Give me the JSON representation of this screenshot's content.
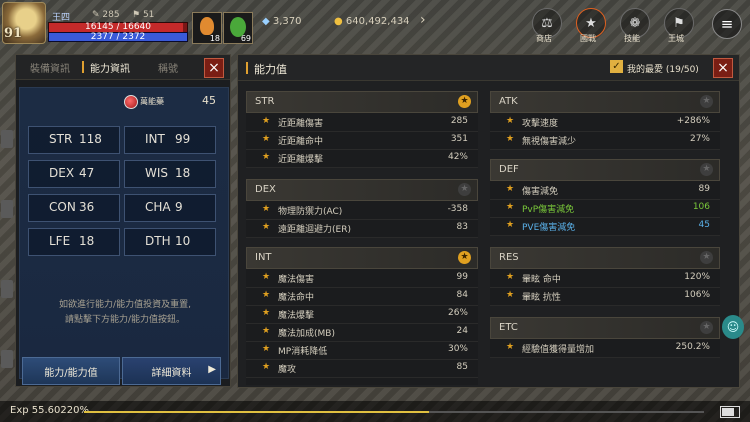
{
  "player": {
    "level": "91",
    "name": "王四",
    "hp_text": "16145 / 16640",
    "hp_fraction": 0.97,
    "mp_text": "2377 / 2372",
    "mp_fraction": 1.0,
    "ac": "285",
    "stat2": "51",
    "slot1_count": "18",
    "slot2_count": "69",
    "crystals": "3,370",
    "gold": "640,492,434",
    "arrow": "›"
  },
  "hud_buttons": [
    {
      "icon": "⚖",
      "label": "商店"
    },
    {
      "icon": "★",
      "label": "國戰"
    },
    {
      "icon": "❁",
      "label": "技能"
    },
    {
      "icon": "⚑",
      "label": "王城"
    },
    {
      "icon": "≡",
      "label": ""
    }
  ],
  "left": {
    "tabs": [
      "裝備資訊",
      "能力資訊",
      "稱號"
    ],
    "close": "×",
    "potion_label": "萬能藥",
    "potion_count": "45",
    "stats": [
      {
        "name": "STR",
        "value": "118"
      },
      {
        "name": "INT",
        "value": "99"
      },
      {
        "name": "DEX",
        "value": "47"
      },
      {
        "name": "WIS",
        "value": "18"
      },
      {
        "name": "CON",
        "value": "36"
      },
      {
        "name": "CHA",
        "value": "9"
      },
      {
        "name": "LFE",
        "value": "18"
      },
      {
        "name": "DTH",
        "value": "10"
      }
    ],
    "info_line1": "如欲進行能力/能力值投資及重置,",
    "info_line2": "請點擊下方能力/能力值按鈕。",
    "btn_ability": "能力/能力值",
    "btn_detail": "詳細資料",
    "btn_detail_arrow": "▶"
  },
  "right": {
    "title": "能力值",
    "favorites_check": "✓",
    "favorites_label": "我的最愛 (19/50)",
    "close": "×",
    "sections_left": [
      {
        "title": "STR",
        "starred": true,
        "star": "★",
        "rows": [
          {
            "label": "近距離傷害",
            "value": "285"
          },
          {
            "label": "近距離命中",
            "value": "351"
          },
          {
            "label": "近距離爆擊",
            "value": "42%"
          }
        ]
      },
      {
        "title": "DEX",
        "starred": false,
        "star": "★",
        "rows": [
          {
            "label": "物理防禦力(AC)",
            "value": "-358"
          },
          {
            "label": "遠距離迴避力(ER)",
            "value": "83"
          }
        ]
      },
      {
        "title": "INT",
        "starred": true,
        "star": "★",
        "rows": [
          {
            "label": "魔法傷害",
            "value": "99"
          },
          {
            "label": "魔法命中",
            "value": "84"
          },
          {
            "label": "魔法爆擊",
            "value": "26%"
          },
          {
            "label": "魔法加成(MB)",
            "value": "24"
          },
          {
            "label": "MP消耗降低",
            "value": "30%"
          },
          {
            "label": "魔攻",
            "value": "85"
          }
        ]
      }
    ],
    "sections_right": [
      {
        "title": "ATK",
        "starred": false,
        "star": "★",
        "rows": [
          {
            "label": "攻擊速度",
            "value": "+286%",
            "color": ""
          },
          {
            "label": "無視傷害減少",
            "value": "27%",
            "color": ""
          }
        ]
      },
      {
        "title": "DEF",
        "starred": false,
        "star": "★",
        "rows": [
          {
            "label": "傷害減免",
            "value": "89",
            "color": ""
          },
          {
            "label": "PvP傷害減免",
            "value": "106",
            "color": "green"
          },
          {
            "label": "PVE傷害減免",
            "value": "45",
            "color": "blue"
          }
        ]
      },
      {
        "title": "RES",
        "starred": false,
        "star": "★",
        "rows": [
          {
            "label": "暈眩 命中",
            "value": "120%",
            "color": ""
          },
          {
            "label": "暈眩 抗性",
            "value": "106%",
            "color": ""
          }
        ]
      },
      {
        "title": "ETC",
        "starred": false,
        "star": "★",
        "rows": [
          {
            "label": "經驗值獲得量增加",
            "value": "250.2%",
            "color": ""
          }
        ]
      }
    ]
  },
  "exp": {
    "text": "Exp  55.60220%",
    "fraction": 0.556,
    "battery_fraction": 0.85
  },
  "colors": {
    "accent_gold": "#e0a020",
    "hp_red": "#7a1616",
    "mp_blue": "#2a3c9c",
    "close_red": "#7a1e14",
    "pvp_green": "#7ac83a",
    "pve_blue": "#5ab0e8"
  }
}
